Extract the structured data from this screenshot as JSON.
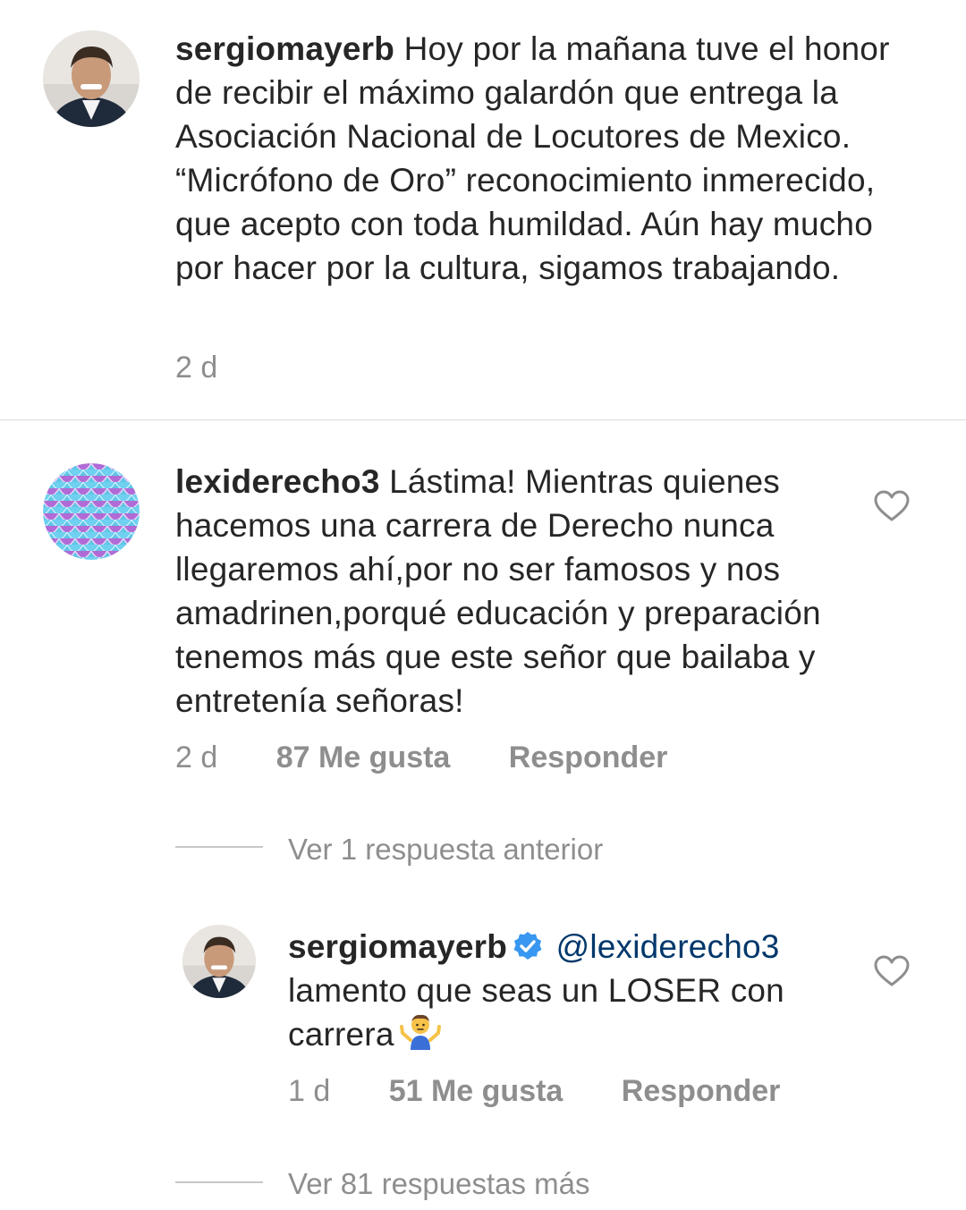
{
  "post": {
    "username": "sergiomayerb",
    "caption": "Hoy por la mañana tuve el honor de recibir el máximo galardón que entrega la Asociación Nacional de Locutores de Mexico. “Micrófono de Oro” reconocimiento inmerecido, que acepto con toda humildad. Aún hay mucho por hacer por la cultura, sigamos trabajando.",
    "time": "2 d"
  },
  "comment": {
    "username": "lexiderecho3",
    "text": "Lástima! Mientras quienes hacemos una carrera de Derecho nunca llegaremos ahí,por no ser famosos y nos amadrinen,porqué educación y preparación tenemos más que este señor que bailaba y entretenía señoras!",
    "time": "2 d",
    "likes": "87 Me gusta",
    "reply": "Responder",
    "view_previous": "Ver 1 respuesta anterior"
  },
  "reply": {
    "username": "sergiomayerb",
    "mention": "@lexiderecho3",
    "text": "lamento que seas un LOSER con carrera",
    "emoji": "person-shrugging",
    "time": "1 d",
    "likes": "51 Me gusta",
    "reply": "Responder",
    "view_more": "Ver 81 respuestas más"
  },
  "colors": {
    "text": "#262626",
    "muted": "#8e8e8e",
    "verified": "#3897f0",
    "mention": "#00376b",
    "divider": "#dbdbdb"
  }
}
